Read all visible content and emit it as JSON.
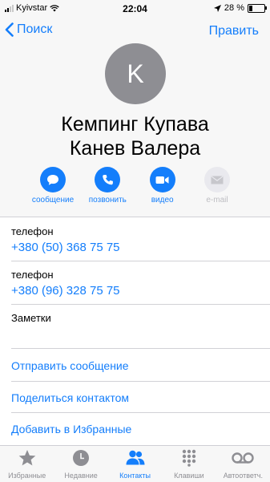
{
  "status": {
    "carrier": "Kyivstar",
    "time": "22:04",
    "battery": "28 %",
    "battery_level": 0.28
  },
  "nav": {
    "back_label": "Поиск",
    "edit_label": "Править"
  },
  "contact": {
    "initial": "K",
    "name_line1": "Кемпинг Купава",
    "name_line2": "Канев Валера"
  },
  "actions": [
    {
      "label": "сообщение",
      "icon": "message-bubble-icon",
      "enabled": true
    },
    {
      "label": "позвонить",
      "icon": "phone-icon",
      "enabled": true
    },
    {
      "label": "видео",
      "icon": "video-camera-icon",
      "enabled": true
    },
    {
      "label": "e-mail",
      "icon": "envelope-icon",
      "enabled": false
    }
  ],
  "phones": [
    {
      "label": "телефон",
      "number": "+380 (50) 368 75 75"
    },
    {
      "label": "телефон",
      "number": "+380 (96) 328 75 75"
    }
  ],
  "notes_label": "Заметки",
  "links": {
    "send_message": "Отправить сообщение",
    "share_contact": "Поделиться контактом",
    "add_favorites": "Добавить в Избранные"
  },
  "tabs": [
    {
      "label": "Избранные",
      "icon": "star-icon",
      "active": false
    },
    {
      "label": "Недавние",
      "icon": "clock-icon",
      "active": false
    },
    {
      "label": "Контакты",
      "icon": "contacts-icon",
      "active": true
    },
    {
      "label": "Клавиши",
      "icon": "keypad-icon",
      "active": false
    },
    {
      "label": "Автоответч.",
      "icon": "voicemail-icon",
      "active": false
    }
  ],
  "colors": {
    "accent": "#147efb",
    "tab_inactive": "#8e8e93",
    "avatar": "#8e8e93"
  }
}
